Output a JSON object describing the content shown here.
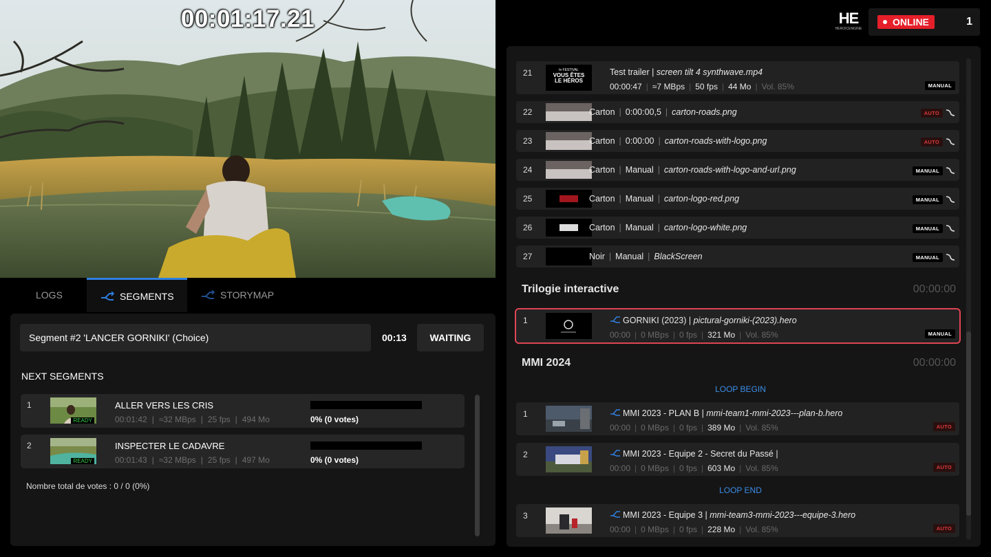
{
  "player": {
    "timecode": "00:01:17.21"
  },
  "tabs": [
    {
      "label": "LOGS"
    },
    {
      "label": "SEGMENTS"
    },
    {
      "label": "STORYMAP"
    }
  ],
  "segment": {
    "current": "Segment #2 'LANCER GORNIKI' (Choice)",
    "time": "00:13",
    "status": "WAITING"
  },
  "next_segments": {
    "title": "NEXT SEGMENTS",
    "items": [
      {
        "num": "1",
        "ready": "READY",
        "title": "ALLER VERS LES CRIS",
        "duration": "00:01:42",
        "rate": "≈32 MBps",
        "fps": "25 fps",
        "size": "494 Mo",
        "votes": "0% (0 votes)"
      },
      {
        "num": "2",
        "ready": "READY",
        "title": "INSPECTER LE CADAVRE",
        "duration": "00:01:43",
        "rate": "≈32 MBps",
        "fps": "25 fps",
        "size": "497 Mo",
        "votes": "0% (0 votes)"
      }
    ],
    "total_votes": "Nombre total de votes : 0 / 0 (0%)"
  },
  "header": {
    "logo_text": "HE",
    "logo_sub": "HEROICENGINE",
    "status": "ONLINE",
    "count": "1"
  },
  "playlist": {
    "top_item": {
      "num": "21",
      "name": "Test trailer",
      "file": "screen tilt 4 synthwave.mp4",
      "duration": "00:00:47",
      "rate": "≈7 MBps",
      "fps": "50 fps",
      "size": "44 Mo",
      "vol": "Vol. 85%",
      "badge": "MANUAL",
      "thumb_text": [
        "le FESTIVAL",
        "VOUS ÊTES",
        "LE HÉROS"
      ]
    },
    "cartons": [
      {
        "num": "22",
        "type": "Carton",
        "mode": "0:00:00,5",
        "file": "carton-roads.png",
        "badge": "AUTO"
      },
      {
        "num": "23",
        "type": "Carton",
        "mode": "0:00:00",
        "file": "carton-roads-with-logo.png",
        "badge": "AUTO"
      },
      {
        "num": "24",
        "type": "Carton",
        "mode": "Manual",
        "file": "carton-roads-with-logo-and-url.png",
        "badge": "MANUAL"
      },
      {
        "num": "25",
        "type": "Carton",
        "mode": "Manual",
        "file": "carton-logo-red.png",
        "badge": "MANUAL"
      },
      {
        "num": "26",
        "type": "Carton",
        "mode": "Manual",
        "file": "carton-logo-white.png",
        "badge": "MANUAL"
      },
      {
        "num": "27",
        "type": "Noir",
        "mode": "Manual",
        "file": "BlackScreen",
        "badge": "MANUAL"
      }
    ],
    "section1": {
      "title": "Trilogie interactive",
      "time": "00:00:00",
      "item": {
        "num": "1",
        "name": "GORNIKI (2023)",
        "file": "pictural-gorniki-(2023).hero",
        "duration": "00:00",
        "rate": "0 MBps",
        "fps": "0 fps",
        "size": "321 Mo",
        "vol": "Vol. 85%",
        "badge": "MANUAL"
      }
    },
    "section2": {
      "title": "MMI 2024",
      "time": "00:00:00",
      "loop_begin": "LOOP BEGIN",
      "loop_end": "LOOP END",
      "items": [
        {
          "num": "1",
          "name": "MMI 2023 - PLAN B",
          "file": "mmi-team1-mmi-2023---plan-b.hero",
          "duration": "00:00",
          "rate": "0 MBps",
          "fps": "0 fps",
          "size": "389 Mo",
          "vol": "Vol. 85%",
          "badge": "AUTO"
        },
        {
          "num": "2",
          "name": "MMI 2023 - Equipe 2 - Secret du Passé",
          "file": "",
          "duration": "00:00",
          "rate": "0 MBps",
          "fps": "0 fps",
          "size": "603 Mo",
          "vol": "Vol. 85%",
          "badge": "AUTO"
        },
        {
          "num": "3",
          "name": "MMI 2023 - Equipe 3",
          "file": "mmi-team3-mmi-2023---equipe-3.hero",
          "duration": "00:00",
          "rate": "0 MBps",
          "fps": "0 fps",
          "size": "228 Mo",
          "vol": "Vol. 85%",
          "badge": "AUTO"
        }
      ]
    }
  },
  "colors": {
    "accent": "#2f7fe0",
    "online": "#e51f2a",
    "auto": "#d93a3a",
    "ready": "#39d14a",
    "selected": "#e04555"
  }
}
